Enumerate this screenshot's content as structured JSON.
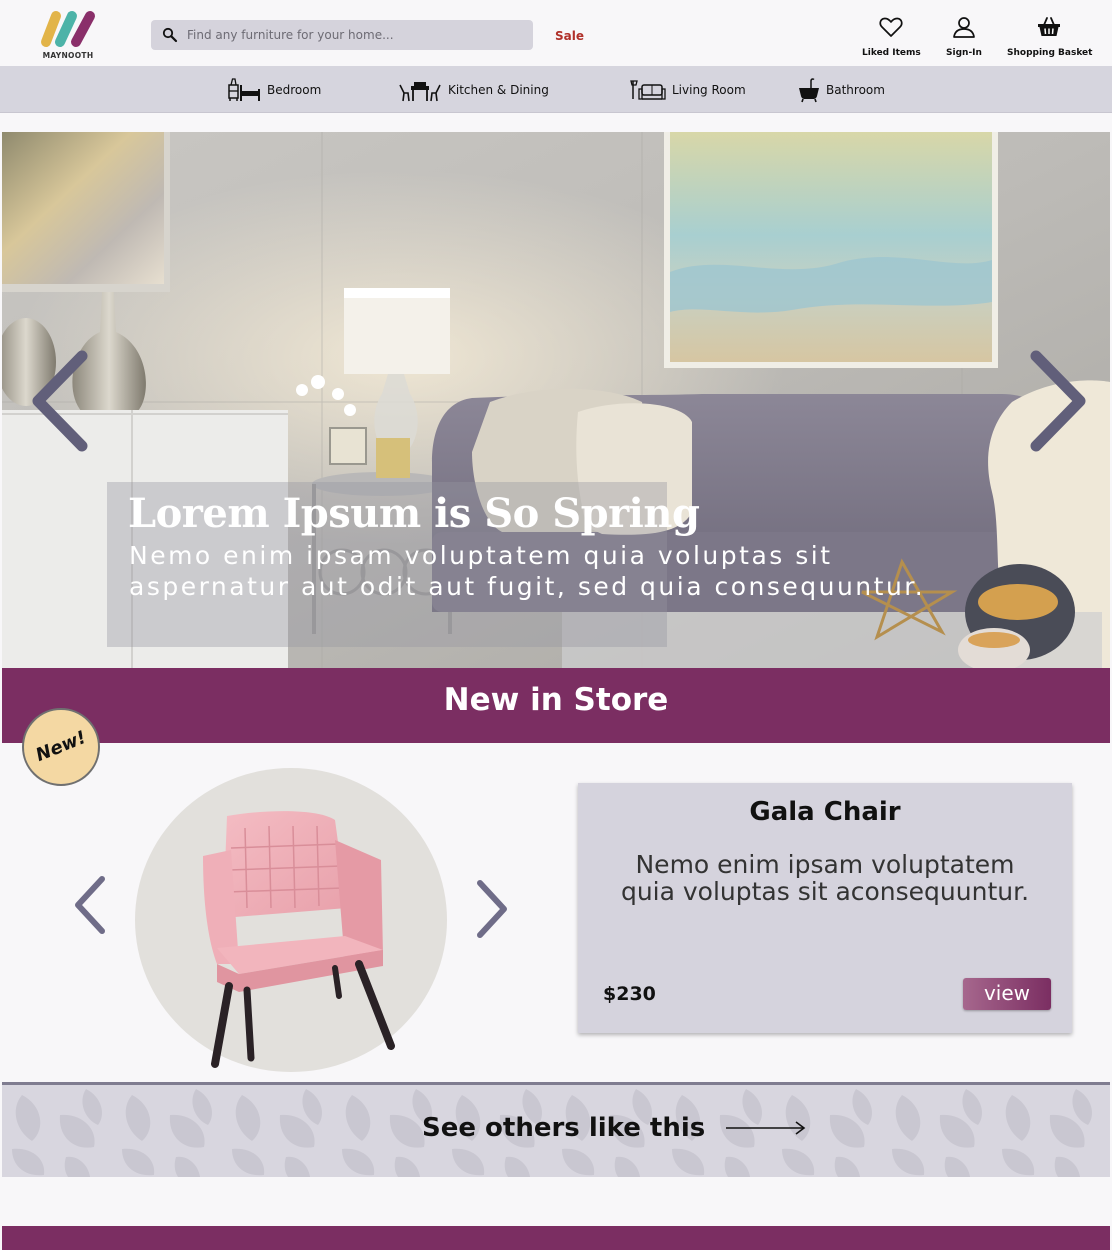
{
  "brand": {
    "name": "MAYNOOTH"
  },
  "search": {
    "placeholder": "Find any furniture for your home..."
  },
  "header": {
    "sale_label": "Sale",
    "liked_label": "Liked Items",
    "signin_label": "Sign-In",
    "basket_label": "Shopping Basket"
  },
  "categories": [
    {
      "label": "Bedroom",
      "icon": "bedroom-icon"
    },
    {
      "label": "Kitchen & Dining",
      "icon": "kitchen-dining-icon"
    },
    {
      "label": "Living Room",
      "icon": "living-room-icon"
    },
    {
      "label": "Bathroom",
      "icon": "bathtub-icon"
    }
  ],
  "hero": {
    "title": "Lorem Ipsum is So Spring",
    "text": "Nemo enim ipsam voluptatem quia voluptas sit aspernatur aut odit aut fugit, sed quia consequuntur."
  },
  "new_in_store": {
    "heading": "New in Store",
    "badge": "New!",
    "product": {
      "name": "Gala Chair",
      "description": "Nemo enim ipsam voluptatem quia voluptas sit aconsequuntur.",
      "price": "$230",
      "view_label": "view"
    }
  },
  "see_others": {
    "label": "See others like this"
  },
  "colors": {
    "brand_purple": "#7b2e62",
    "sale_red": "#b0302a",
    "nav_gray": "#d6d5de",
    "arrow_slate": "#6f6c88",
    "badge_yellow": "#f4d8a3"
  }
}
